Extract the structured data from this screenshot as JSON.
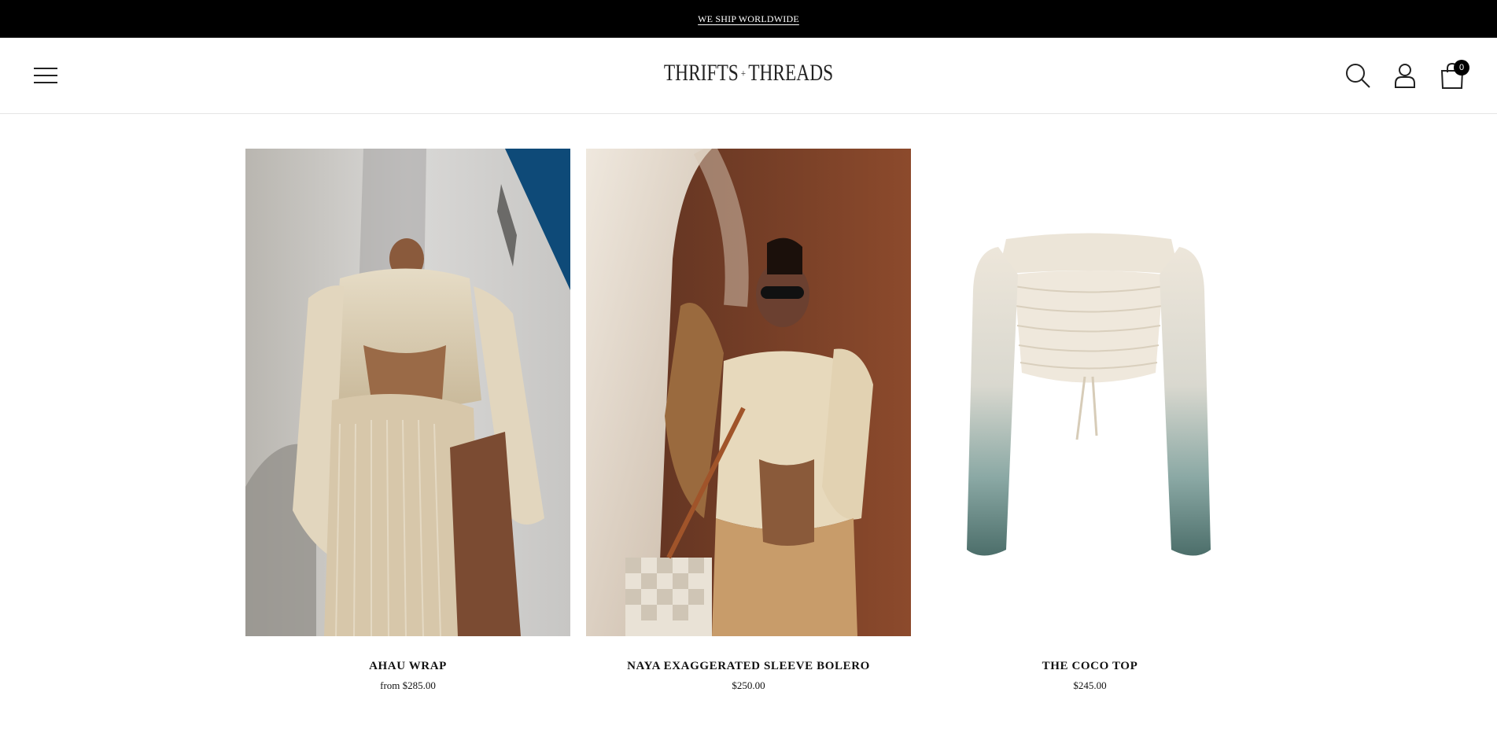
{
  "announcement": {
    "text": "WE SHIP WORLDWIDE"
  },
  "header": {
    "logo": {
      "left": "THRIFTS",
      "plus": "+",
      "right": "THREADS"
    },
    "menu_icon": "hamburger-icon",
    "search_icon": "search-icon",
    "account_icon": "user-icon",
    "cart_icon": "shopping-bag-icon",
    "cart_count": "0"
  },
  "products": [
    {
      "title": "AHAU WRAP",
      "price": "from $285.00"
    },
    {
      "title": "NAYA EXAGGERATED SLEEVE BOLERO",
      "price": "$250.00"
    },
    {
      "title": "THE COCO TOP",
      "price": "$245.00"
    }
  ],
  "colors": {
    "announce_bg": "#000000",
    "text": "#111111",
    "accent": "#000000"
  }
}
